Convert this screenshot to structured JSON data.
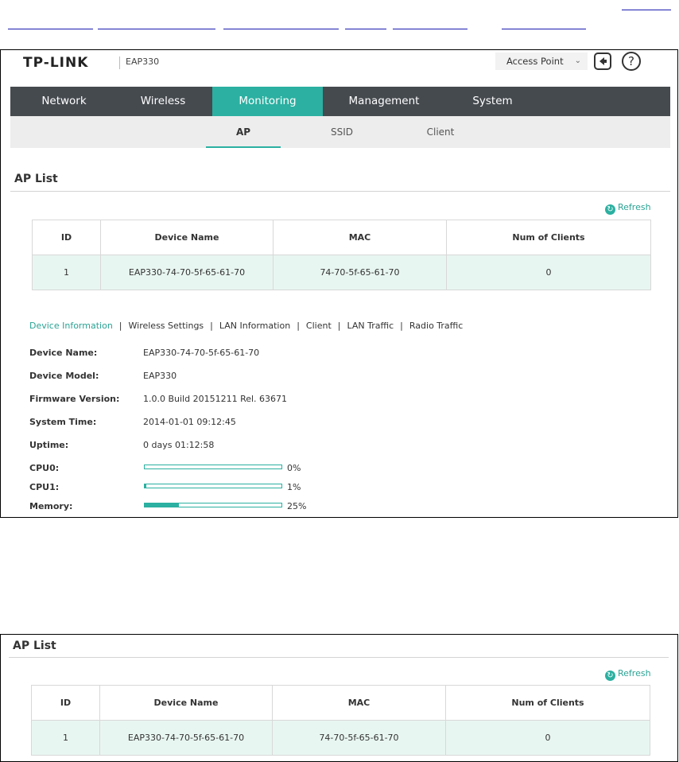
{
  "header": {
    "logo": "TP-LINK",
    "model": "EAP330",
    "mode_select": "Access Point"
  },
  "nav": {
    "items": [
      {
        "label": "Network"
      },
      {
        "label": "Wireless"
      },
      {
        "label": "Monitoring",
        "active": true
      },
      {
        "label": "Management"
      },
      {
        "label": "System"
      }
    ]
  },
  "subnav": {
    "items": [
      {
        "label": "AP",
        "active": true
      },
      {
        "label": "SSID"
      },
      {
        "label": "Client"
      }
    ]
  },
  "ap_list": {
    "title": "AP List",
    "refresh_label": "Refresh",
    "columns": [
      "ID",
      "Device Name",
      "MAC",
      "Num of Clients"
    ],
    "rows": [
      [
        "1",
        "EAP330-74-70-5f-65-61-70",
        "74-70-5f-65-61-70",
        "0"
      ]
    ]
  },
  "detail_tabs": [
    "Device Information",
    "Wireless Settings",
    "LAN Information",
    "Client",
    "LAN Traffic",
    "Radio Traffic"
  ],
  "device_info": {
    "device_name_label": "Device Name:",
    "device_name": "EAP330-74-70-5f-65-61-70",
    "device_model_label": "Device Model:",
    "device_model": "EAP330",
    "firmware_label": "Firmware Version:",
    "firmware": "1.0.0 Build 20151211 Rel. 63671",
    "system_time_label": "System Time:",
    "system_time": "2014-01-01 09:12:45",
    "uptime_label": "Uptime:",
    "uptime": "0 days 01:12:58",
    "cpu0_label": "CPU0:",
    "cpu0": "0%",
    "cpu0_value": 0,
    "cpu1_label": "CPU1:",
    "cpu1": "1%",
    "cpu1_value": 1,
    "memory_label": "Memory:",
    "memory": "25%",
    "memory_value": 25
  },
  "colors": {
    "accent": "#2bb0a1",
    "nav_bg": "#454a4f",
    "row_bg": "#e8f6f1"
  }
}
